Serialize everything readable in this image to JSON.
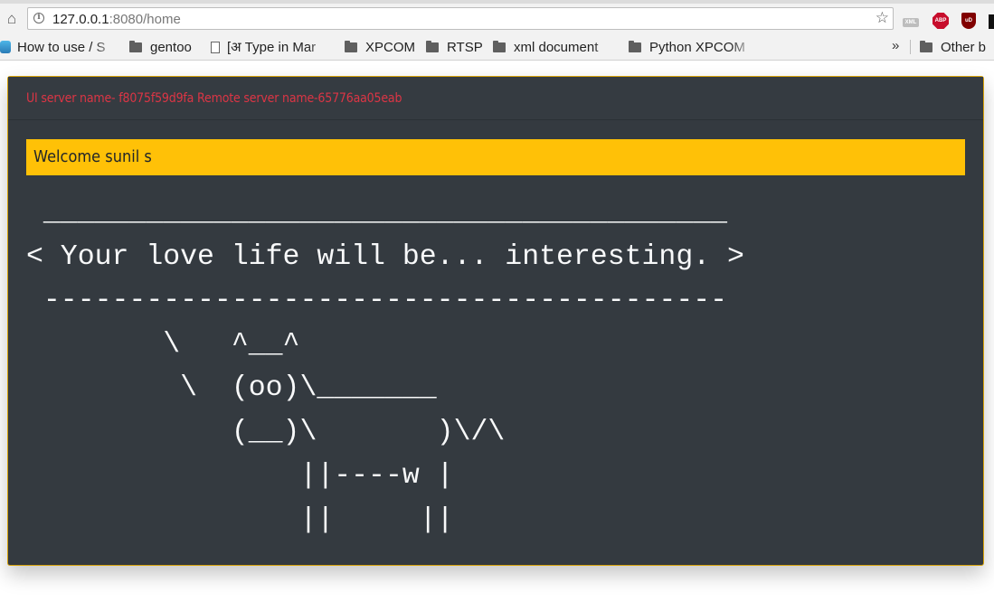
{
  "browser": {
    "url_host": "127.0.0.1",
    "url_rest": ":8080/home",
    "icons": [
      "home-icon",
      "info-icon",
      "star-icon",
      "xml-extension-icon",
      "adblock-plus-icon",
      "ublock-icon"
    ],
    "extensions": {
      "abp_label": "ABP",
      "ublock_label": "uD"
    },
    "bookmarks": [
      {
        "label": "How to use / S",
        "icon": "chrome-favicon"
      },
      {
        "label": "gentoo",
        "icon": "folder-icon"
      },
      {
        "label": "[अ Type in Mar",
        "icon": "page-icon"
      },
      {
        "label": "XPCOM",
        "icon": "folder-icon"
      },
      {
        "label": "RTSP",
        "icon": "folder-icon"
      },
      {
        "label": "xml document",
        "icon": "folder-icon"
      },
      {
        "label": "Python XPCOM",
        "icon": "folder-icon"
      }
    ],
    "overflow_label": "»",
    "other_bookmarks": "Other b"
  },
  "page": {
    "server_info": "UI server name- f8075f59d9fa Remote server name-65776aa05eab",
    "welcome": "Welcome sunil s",
    "cowsay": " ________________________________________\n< Your love life will be... interesting. >\n ----------------------------------------\n        \\   ^__^\n         \\  (oo)\\_______\n            (__)\\       )\\/\\\n                ||----w |\n                ||     ||"
  },
  "colors": {
    "card_bg": "#343a40",
    "card_border": "#d6a20a",
    "server_info": "#dc3545",
    "welcome_bg": "#ffc107",
    "cowsay_text": "#f8f9fa"
  }
}
